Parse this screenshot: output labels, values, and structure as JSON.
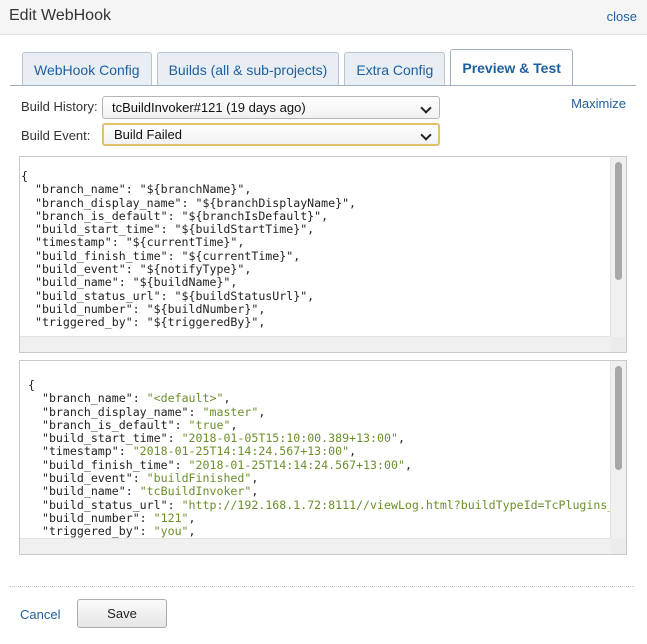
{
  "dialog": {
    "title": "Edit WebHook",
    "close_label": "close"
  },
  "tabs": [
    {
      "label": "WebHook Config",
      "active": false
    },
    {
      "label": "Builds (all & sub-projects)",
      "active": false
    },
    {
      "label": "Extra Config",
      "active": false
    },
    {
      "label": "Preview & Test",
      "active": true
    }
  ],
  "form": {
    "build_history_label": "Build History:",
    "build_history_value": "tcBuildInvoker#121 (19 days ago)",
    "build_event_label": "Build Event:",
    "build_event_value": "Build Failed",
    "maximize_label": "Maximize"
  },
  "template_lines": [
    [
      {
        "t": "{"
      }
    ],
    [
      {
        "t": "  \"branch_name\": \"${branchName}\","
      }
    ],
    [
      {
        "t": "  \"branch_display_name\": \"${branchDisplayName}\","
      }
    ],
    [
      {
        "t": "  \"branch_is_default\": \"${branchIsDefault}\","
      }
    ],
    [
      {
        "t": "  \"build_start_time\": \"${buildStartTime}\","
      }
    ],
    [
      {
        "t": "  \"timestamp\": \"${currentTime}\","
      }
    ],
    [
      {
        "t": "  \"build_finish_time\": \"${currentTime}\","
      }
    ],
    [
      {
        "t": "  \"build_event\": \"${notifyType}\","
      }
    ],
    [
      {
        "t": "  \"build_name\": \"${buildName}\","
      }
    ],
    [
      {
        "t": "  \"build_status_url\": \"${buildStatusUrl}\","
      }
    ],
    [
      {
        "t": "  \"build_number\": \"${buildNumber}\","
      }
    ],
    [
      {
        "t": "  \"triggered_by\": \"${triggeredBy}\","
      }
    ]
  ],
  "preview_lines": [
    [
      {
        "t": "{"
      }
    ],
    [
      {
        "t": "  \"branch_name\": "
      },
      {
        "t": "\"<default>\"",
        "s": 1
      },
      {
        "t": ","
      }
    ],
    [
      {
        "t": "  \"branch_display_name\": "
      },
      {
        "t": "\"master\"",
        "s": 1
      },
      {
        "t": ","
      }
    ],
    [
      {
        "t": "  \"branch_is_default\": "
      },
      {
        "t": "\"true\"",
        "s": 1
      },
      {
        "t": ","
      }
    ],
    [
      {
        "t": "  \"build_start_time\": "
      },
      {
        "t": "\"2018-01-05T15:10:00.389+13:00\"",
        "s": 1
      },
      {
        "t": ","
      }
    ],
    [
      {
        "t": "  \"timestamp\": "
      },
      {
        "t": "\"2018-01-25T14:14:24.567+13:00\"",
        "s": 1
      },
      {
        "t": ","
      }
    ],
    [
      {
        "t": "  \"build_finish_time\": "
      },
      {
        "t": "\"2018-01-25T14:14:24.567+13:00\"",
        "s": 1
      },
      {
        "t": ","
      }
    ],
    [
      {
        "t": "  \"build_event\": "
      },
      {
        "t": "\"buildFinished\"",
        "s": 1
      },
      {
        "t": ","
      }
    ],
    [
      {
        "t": "  \"build_name\": "
      },
      {
        "t": "\"tcBuildInvoker\"",
        "s": 1
      },
      {
        "t": ","
      }
    ],
    [
      {
        "t": "  \"build_status_url\": "
      },
      {
        "t": "\"http://192.168.1.72:8111//viewLog.html?buildTypeId=TcPlugins_",
        "s": 1
      }
    ],
    [
      {
        "t": "  \"build_number\": "
      },
      {
        "t": "\"121\"",
        "s": 1
      },
      {
        "t": ","
      }
    ],
    [
      {
        "t": "  \"triggered_by\": "
      },
      {
        "t": "\"you\"",
        "s": 1
      },
      {
        "t": ","
      }
    ]
  ],
  "footer": {
    "cancel_label": "Cancel",
    "save_label": "Save"
  },
  "colors": {
    "link": "#1f5f9e",
    "string_value": "#6a8f2a",
    "focus_border": "#e0c16c"
  }
}
